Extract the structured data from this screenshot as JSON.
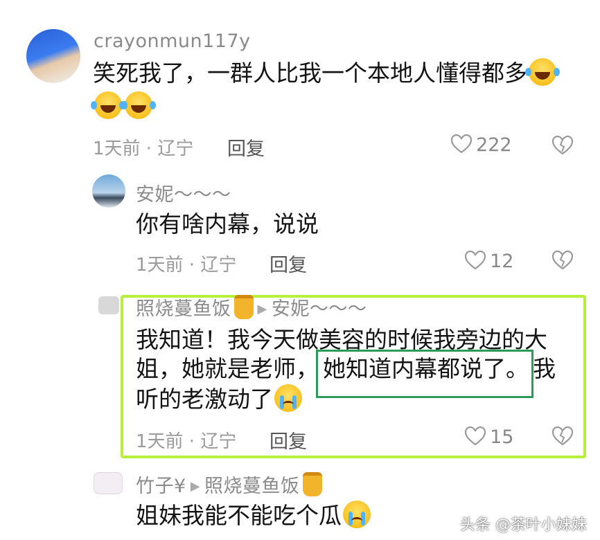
{
  "comments": [
    {
      "username": "crayonmun117y",
      "text_line1": "笑死我了，一群人比我一个本地人懂得都多",
      "meta": "1天前 · 辽宁",
      "reply": "回复",
      "likes": "222"
    },
    {
      "username": "安妮～～～",
      "text": "你有啥内幕，说说",
      "meta": "1天前 · 辽宁",
      "reply": "回复",
      "likes": "12"
    },
    {
      "username": "照烧蔓鱼饭",
      "reply_to": "安妮～～～",
      "text_line1": "我知道！我今天做美容的时候我旁边的大",
      "text_line2a": "姐，她就是老师，",
      "text_line2b": "她知道内幕都说了。",
      "text_line2c": "我",
      "text_line3": "听的老激动了",
      "meta": "1天前 · 辽宁",
      "reply": "回复",
      "likes": "15"
    },
    {
      "username": "竹子¥",
      "reply_to": "照烧蔓鱼饭",
      "text": "姐妹我能不能吃个瓜"
    }
  ],
  "watermark": "头条 @茶叶小妹妹",
  "colors": {
    "highlight_outer": "#b8ef3a",
    "highlight_inner": "#2e9a5a"
  }
}
